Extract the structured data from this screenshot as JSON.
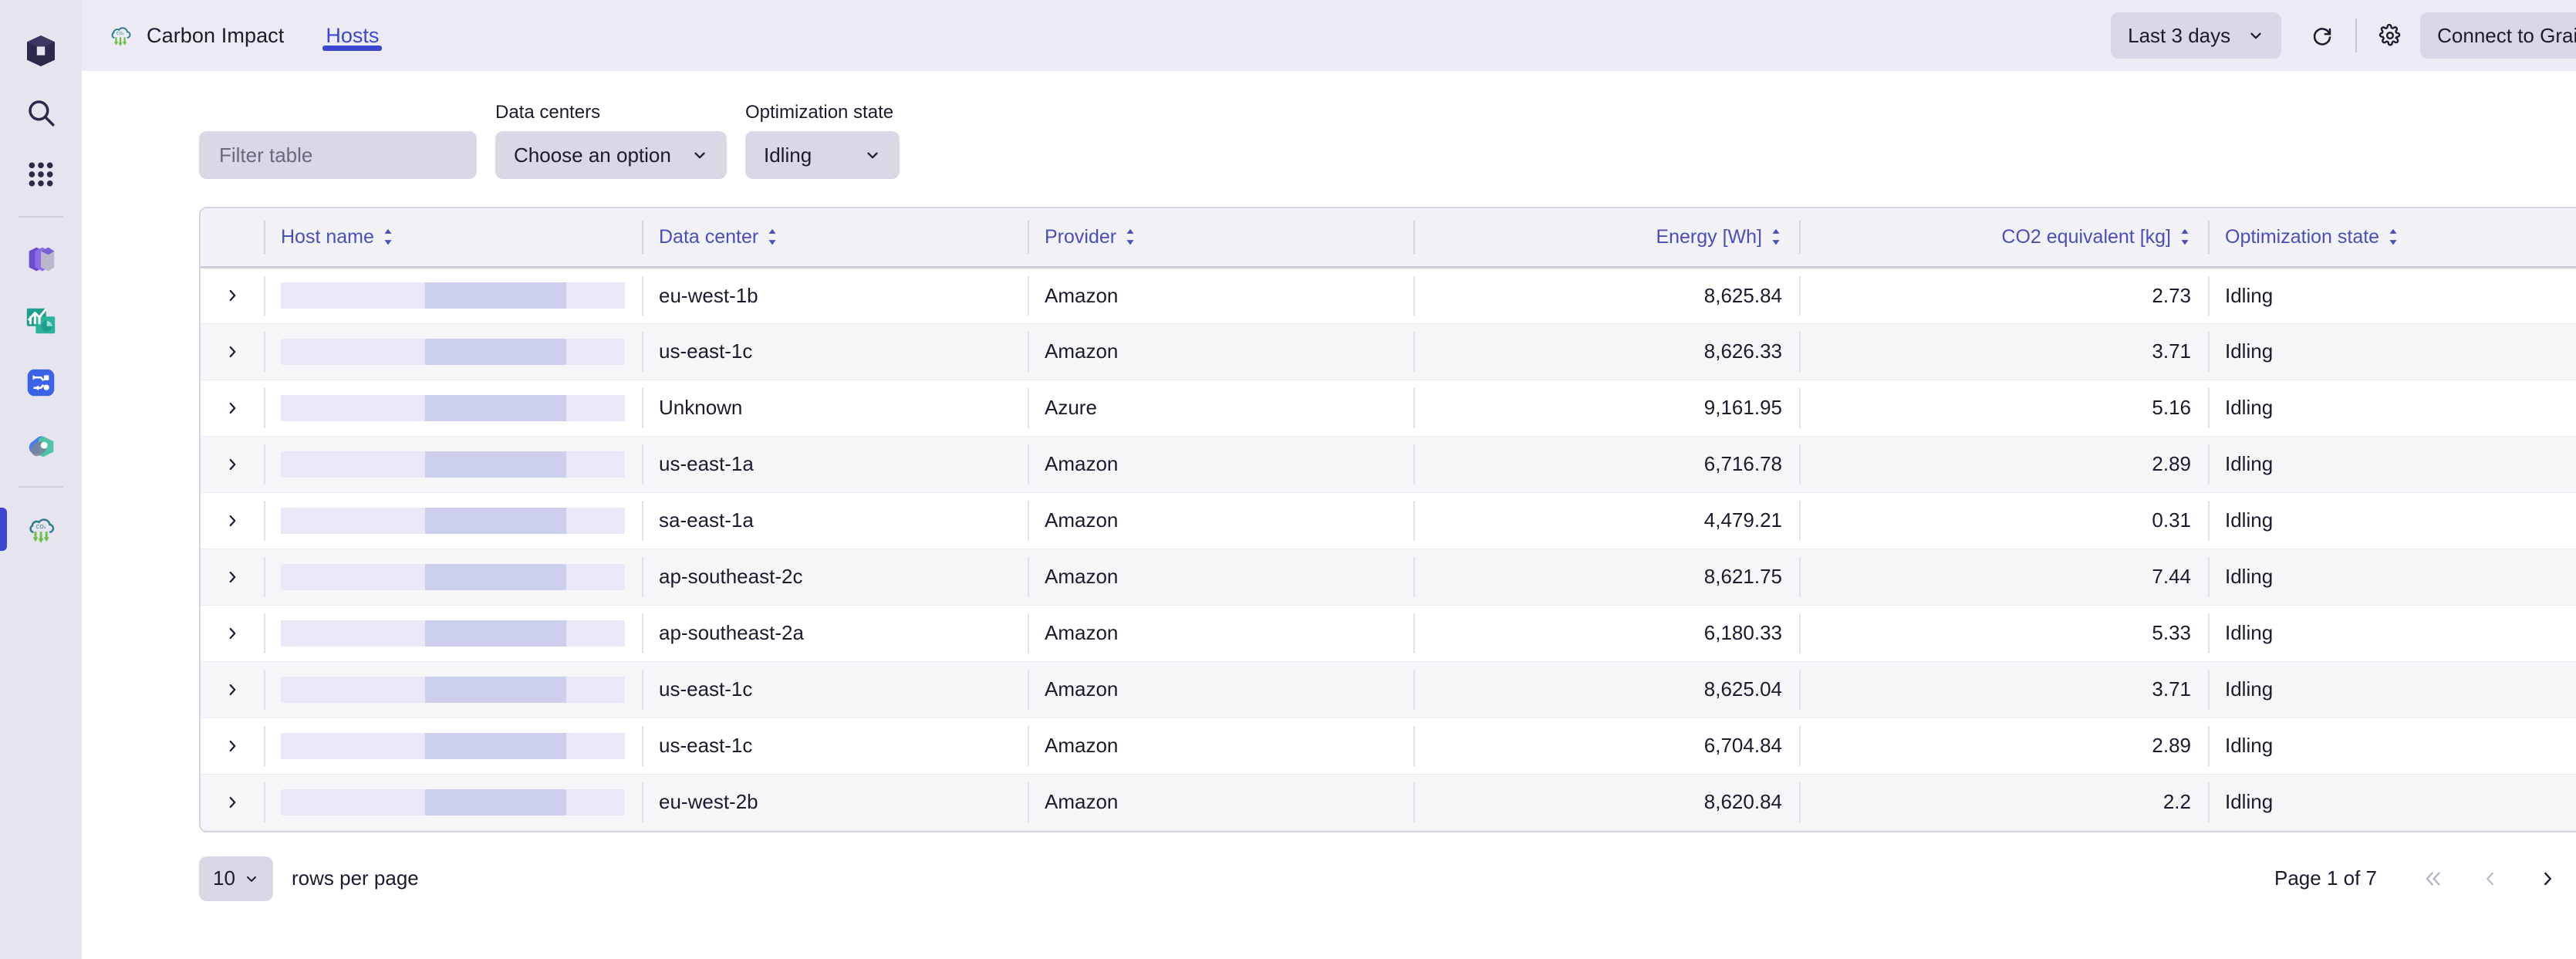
{
  "sidebar": {
    "items": [
      {
        "name": "dynatrace-logo",
        "icon": "cube-logo-icon",
        "label": ""
      },
      {
        "name": "search",
        "icon": "search-icon",
        "label": ""
      },
      {
        "name": "apps-grid",
        "icon": "grid-apps-icon",
        "label": ""
      },
      {
        "name": "app-purple-cube",
        "icon": "layered-cube-icon",
        "label": ""
      },
      {
        "name": "app-analytics",
        "icon": "chart-analytics-icon",
        "label": ""
      },
      {
        "name": "app-workflows",
        "icon": "workflow-icon",
        "label": ""
      },
      {
        "name": "app-kubernetes",
        "icon": "pill-shape-icon",
        "label": ""
      },
      {
        "name": "app-carbon-impact",
        "icon": "carbon-cloud-icon",
        "label": ""
      }
    ]
  },
  "header": {
    "app_icon": "carbon-cloud-icon",
    "title": "Carbon Impact",
    "tabs": [
      {
        "label": "Hosts",
        "active": true
      }
    ],
    "timeframe": {
      "label": "Last 3 days",
      "chevron": "chevron-down-icon"
    },
    "refresh_icon": "refresh-icon",
    "settings_icon": "gear-icon",
    "connect": {
      "label": "Connect to Grail",
      "chevron": "chevron-down-icon"
    }
  },
  "filters": {
    "search": {
      "placeholder": "Filter table",
      "value": ""
    },
    "data_centers": {
      "label": "Data centers",
      "value": "Choose an option"
    },
    "optimization_state": {
      "label": "Optimization state",
      "value": "Idling"
    }
  },
  "table": {
    "columns": [
      {
        "label": "Host name",
        "align": "left",
        "sortable": true
      },
      {
        "label": "Data center",
        "align": "left",
        "sortable": true
      },
      {
        "label": "Provider",
        "align": "left",
        "sortable": true
      },
      {
        "label": "Energy [Wh]",
        "align": "right",
        "sortable": true
      },
      {
        "label": "CO2 equivalent [kg]",
        "align": "right",
        "sortable": true
      },
      {
        "label": "Optimization state",
        "align": "left",
        "sortable": true
      }
    ],
    "rows": [
      {
        "host_name": "",
        "data_center": "eu-west-1b",
        "provider": "Amazon",
        "energy": "8,625.84",
        "co2": "2.73",
        "state": "Idling"
      },
      {
        "host_name": "",
        "data_center": "us-east-1c",
        "provider": "Amazon",
        "energy": "8,626.33",
        "co2": "3.71",
        "state": "Idling"
      },
      {
        "host_name": "",
        "data_center": "Unknown",
        "provider": "Azure",
        "energy": "9,161.95",
        "co2": "5.16",
        "state": "Idling"
      },
      {
        "host_name": "",
        "data_center": "us-east-1a",
        "provider": "Amazon",
        "energy": "6,716.78",
        "co2": "2.89",
        "state": "Idling"
      },
      {
        "host_name": "",
        "data_center": "sa-east-1a",
        "provider": "Amazon",
        "energy": "4,479.21",
        "co2": "0.31",
        "state": "Idling"
      },
      {
        "host_name": "",
        "data_center": "ap-southeast-2c",
        "provider": "Amazon",
        "energy": "8,621.75",
        "co2": "7.44",
        "state": "Idling"
      },
      {
        "host_name": "",
        "data_center": "ap-southeast-2a",
        "provider": "Amazon",
        "energy": "6,180.33",
        "co2": "5.33",
        "state": "Idling"
      },
      {
        "host_name": "",
        "data_center": "us-east-1c",
        "provider": "Amazon",
        "energy": "8,625.04",
        "co2": "3.71",
        "state": "Idling"
      },
      {
        "host_name": "",
        "data_center": "us-east-1c",
        "provider": "Amazon",
        "energy": "6,704.84",
        "co2": "2.89",
        "state": "Idling"
      },
      {
        "host_name": "",
        "data_center": "eu-west-2b",
        "provider": "Amazon",
        "energy": "8,620.84",
        "co2": "2.2",
        "state": "Idling"
      }
    ]
  },
  "footer": {
    "rows_per_page_value": "10",
    "rows_per_page_label": "rows per page",
    "page_status": "Page 1 of 7",
    "first_page_icon": "chevron-double-left-icon",
    "prev_page_icon": "chevron-left-icon",
    "next_page_icon": "chevron-right-icon",
    "last_page_icon": "chevron-double-right-icon"
  },
  "colors": {
    "accent": "#3b47d1",
    "header_bg": "#eceaf2",
    "sidebar_bg": "#e6e4ee",
    "table_header_bg": "#f2f2f6",
    "control_bg": "#d9d8e6",
    "text": "#1b1a2e",
    "col_header_text": "#4a4fb8",
    "green": "#6cbe45",
    "teal": "#2d7d8a"
  }
}
